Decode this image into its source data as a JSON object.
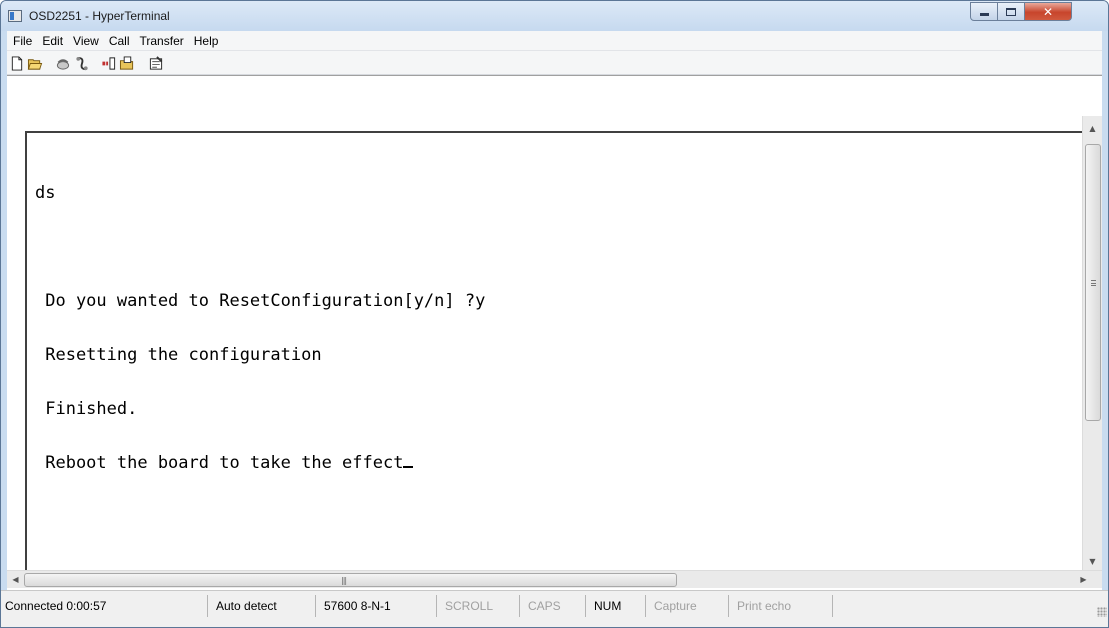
{
  "window": {
    "title": "OSD2251 - HyperTerminal"
  },
  "menu": {
    "items": [
      "File",
      "Edit",
      "View",
      "Call",
      "Transfer",
      "Help"
    ]
  },
  "toolbar": {
    "icons": [
      "new-connection-icon",
      "open-icon",
      "connect-icon",
      "disconnect-icon",
      "send-icon",
      "receive-icon",
      "properties-icon"
    ]
  },
  "terminal": {
    "lines": [
      "ds",
      "",
      " Do you wanted to ResetConfiguration[y/n] ?y",
      " Resetting the configuration",
      " Finished.",
      " Reboot the board to take the effect"
    ]
  },
  "statusbar": {
    "connection": "Connected 0:00:57",
    "detect": "Auto detect",
    "port": "57600 8-N-1",
    "scroll": "SCROLL",
    "caps": "CAPS",
    "num": "NUM",
    "capture": "Capture",
    "print_echo": "Print echo"
  },
  "colors": {
    "close_button": "#c8452c",
    "frame": "#c9dcf0"
  }
}
